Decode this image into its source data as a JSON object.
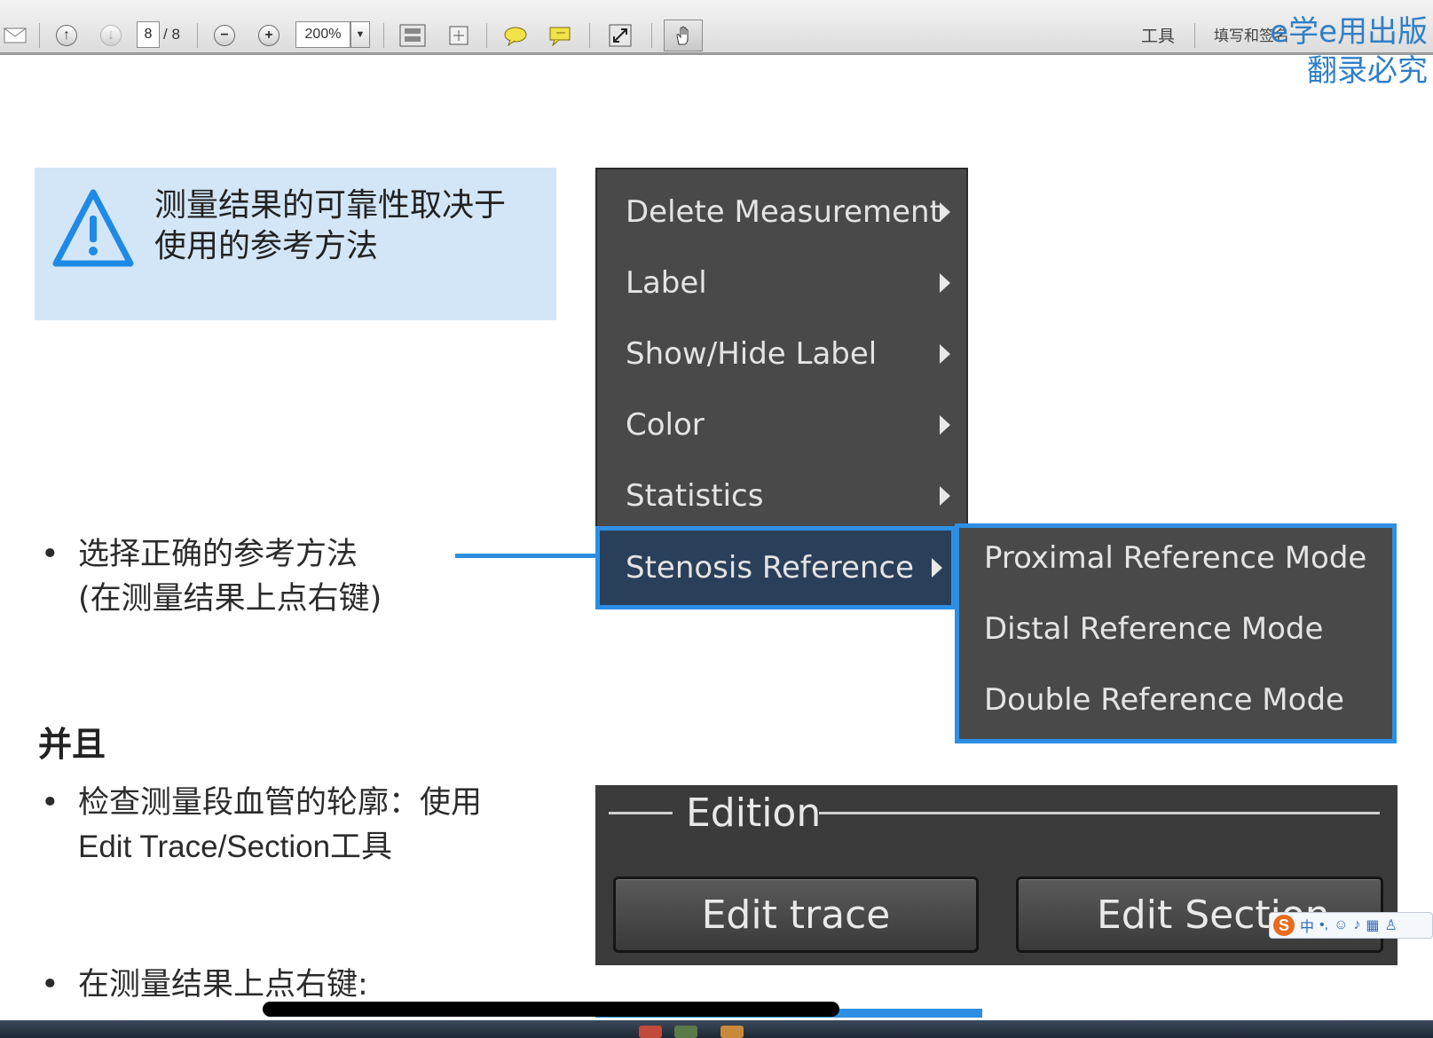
{
  "toolbar": {
    "page_current": "8",
    "page_total": "/ 8",
    "zoom": "200%",
    "tools_label": "工具",
    "fill_sign_label": "填写和签名",
    "icons": [
      "mail-icon",
      "page-up-icon",
      "page-down-icon",
      "zoom-out-icon",
      "zoom-in-icon",
      "fit-page-icon",
      "fit-width-icon",
      "comment-icon",
      "sign-icon",
      "fullscreen-icon",
      "hand-tool-icon"
    ]
  },
  "watermark": {
    "line1": "e学e用出版",
    "line2": "翻录必究"
  },
  "warning": {
    "line1": "测量结果的可靠性取决于",
    "line2": "使用的参考方法"
  },
  "bullets": {
    "select_method_line1": "选择正确的参考方法",
    "select_method_line2": "(在测量结果上点右键)",
    "and_heading": "并且",
    "check_contour_line1": "检查测量段血管的轮廓：使用",
    "check_contour_line2": "Edit Trace/Section工具",
    "right_click": "在测量结果上点右键:"
  },
  "context_menu": {
    "items": [
      {
        "label": "Delete Measurement"
      },
      {
        "label": "Label"
      },
      {
        "label": "Show/Hide Label"
      },
      {
        "label": "Color"
      },
      {
        "label": "Statistics"
      },
      {
        "label": "Stenosis Reference"
      }
    ],
    "active_index": 5
  },
  "submenu": {
    "items": [
      {
        "label": "Proximal Reference Mode"
      },
      {
        "label": "Distal Reference Mode"
      },
      {
        "label": "Double Reference Mode"
      }
    ]
  },
  "edition": {
    "title": "Edition",
    "edit_trace": "Edit trace",
    "edit_section": "Edit Section"
  },
  "ime": {
    "label": "中"
  },
  "colors": {
    "accent_blue": "#2d8fe4",
    "warning_bg": "#d3e6f7",
    "menu_bg": "#494949",
    "panel_bg": "#3b3b3b"
  }
}
